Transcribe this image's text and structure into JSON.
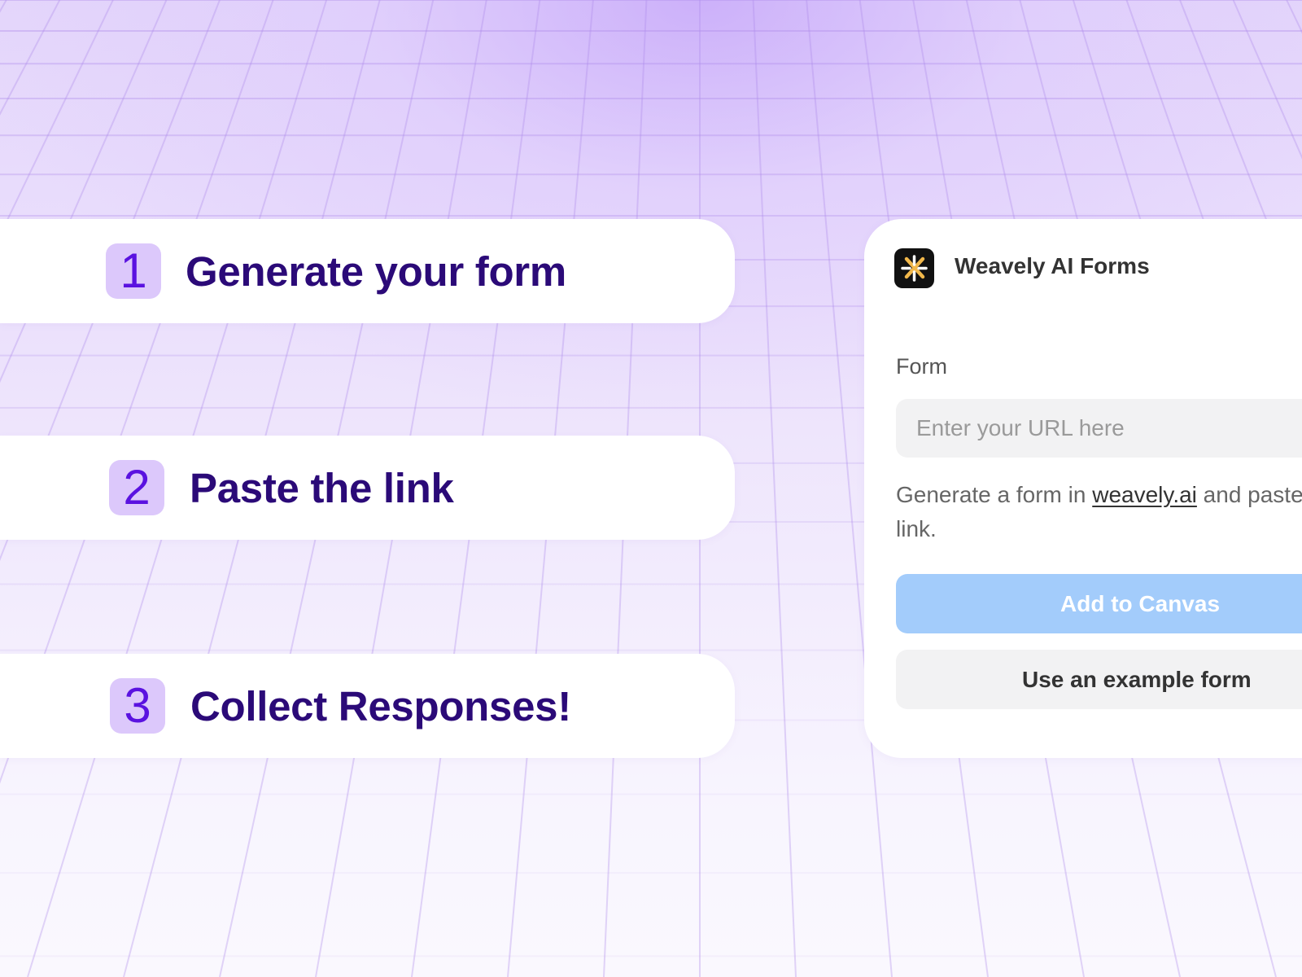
{
  "steps": [
    {
      "number": "1",
      "label": "Generate your form"
    },
    {
      "number": "2",
      "label": "Paste the link"
    },
    {
      "number": "3",
      "label": "Collect Responses!"
    }
  ],
  "panel": {
    "app_icon": "weavely-logo-icon",
    "app_title": "Weavely AI Forms",
    "field_label": "Form",
    "url_placeholder": "Enter your URL here",
    "help_prefix": "Generate a form in ",
    "help_link": "weavely.ai",
    "help_suffix": " and paste the link.",
    "primary_button": "Add to Canvas",
    "secondary_button": "Use an example form"
  },
  "colors": {
    "badge_bg": "#dcc8fb",
    "badge_text": "#5a12e0",
    "step_text": "#2b0a78",
    "primary_button_bg": "#a3ccfb",
    "secondary_button_bg": "#f2f2f3"
  }
}
